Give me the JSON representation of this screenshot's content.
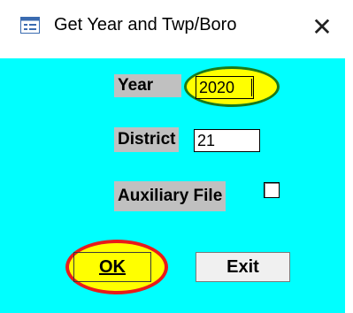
{
  "window": {
    "title": "Get Year and Twp/Boro",
    "close_symbol": "✕",
    "icon": "form-window-icon"
  },
  "form": {
    "year_label": "Year",
    "year_value": "2020",
    "district_label": "District",
    "district_value": "21",
    "aux_label": "Auxiliary File",
    "aux_checked": false
  },
  "buttons": {
    "ok_label": "OK",
    "exit_label": "Exit"
  },
  "colors": {
    "background": "#00ffff",
    "label_bg": "#c0c0c0",
    "highlight_fill": "#ffff00",
    "highlight_green": "#1a7a1a",
    "highlight_red": "#e81b1b"
  }
}
